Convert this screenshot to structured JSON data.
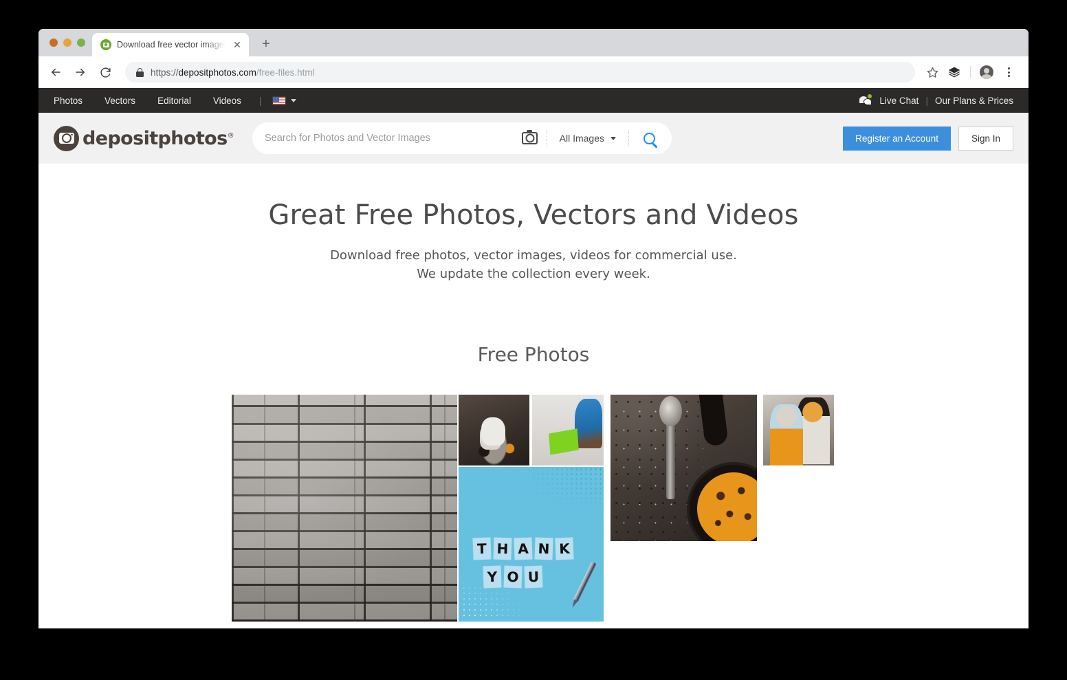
{
  "browser": {
    "tab": {
      "title": "Download free vector images a",
      "favicon_icon": "depositphotos-favicon-icon",
      "close_icon": "close-icon"
    },
    "new_tab_label": "+",
    "nav": {
      "back_icon": "back-arrow-icon",
      "forward_icon": "forward-arrow-icon",
      "reload_icon": "reload-icon"
    },
    "omnibox": {
      "lock_icon": "lock-icon",
      "scheme": "https://",
      "domain": "depositphotos.com",
      "path": "/free-files.html"
    },
    "actions": {
      "bookmark_icon": "star-icon",
      "extension_icon": "layers-icon",
      "profile_icon": "avatar-icon",
      "menu_icon": "kebab-menu-icon"
    }
  },
  "topnav": {
    "links": [
      "Photos",
      "Vectors",
      "Editorial",
      "Videos"
    ],
    "separator": "|",
    "language": {
      "flag_icon": "us-flag-icon",
      "caret_icon": "chevron-down-icon"
    },
    "live_chat": {
      "icon": "live-chat-icon",
      "label": "Live Chat"
    },
    "right_separator": "|",
    "plans_label": "Our Plans & Prices"
  },
  "header": {
    "logo": {
      "mark_icon": "camera-logo-icon",
      "text": "depositphotos",
      "registered_mark": "®"
    },
    "search": {
      "placeholder": "Search for Photos and Vector Images",
      "value": "",
      "camera_icon": "camera-search-icon",
      "filter_label": "All Images",
      "filter_caret_icon": "chevron-down-icon",
      "search_icon": "search-icon"
    },
    "register_label": "Register an Account",
    "signin_label": "Sign In",
    "accent_color": "#3c8fdc"
  },
  "hero": {
    "title": "Great Free Photos, Vectors and Videos",
    "subtitle_line1": "Download free photos, vector images, videos for commercial use.",
    "subtitle_line2": "We update the collection every week."
  },
  "section": {
    "title": "Free Photos"
  },
  "gallery": {
    "items": [
      {
        "name": "stone-wall-photo",
        "alt": "Grey stone brick wall texture"
      },
      {
        "name": "teapot-photo",
        "alt": "White teapot and dessert on dark tray"
      },
      {
        "name": "girl-paper-photo",
        "alt": "Girl holding green paper with boy"
      },
      {
        "name": "thank-you-photo",
        "alt": "Thank You letters on blue background with pen",
        "words": [
          [
            "T",
            "H",
            "A",
            "N",
            "K"
          ],
          [
            "Y",
            "O",
            "U"
          ]
        ]
      },
      {
        "name": "spoon-pan-photo",
        "alt": "Spoon beside pan of orange soup"
      },
      {
        "name": "couple-photo",
        "alt": "Couple embracing outdoors"
      }
    ]
  }
}
